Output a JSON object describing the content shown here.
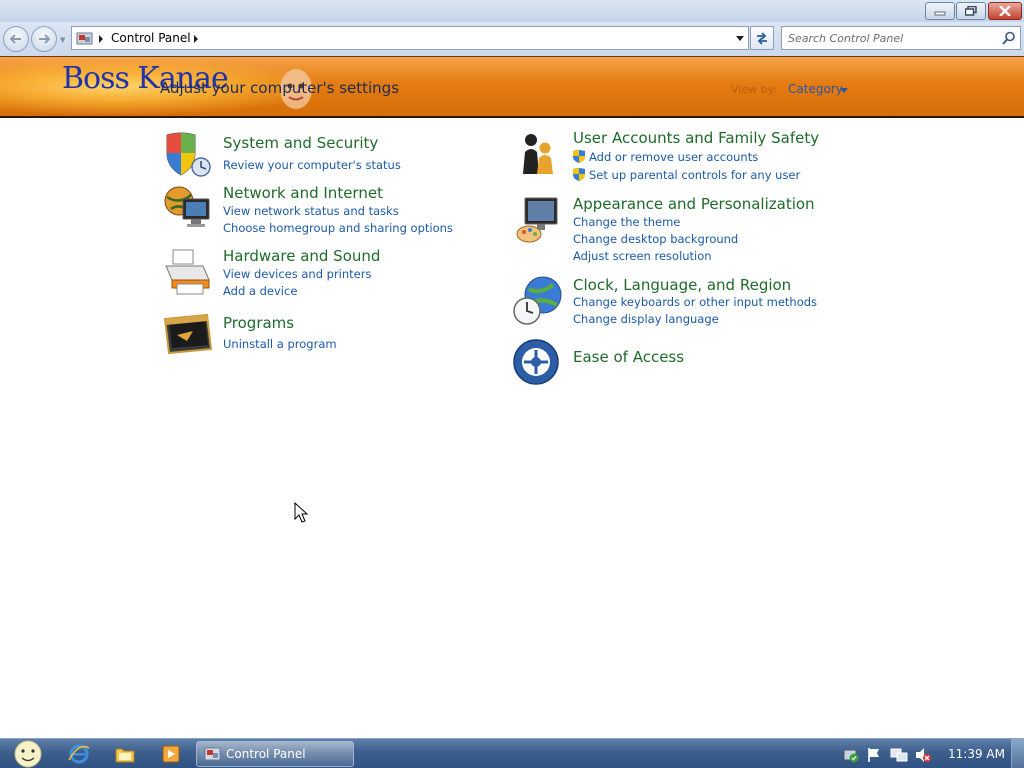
{
  "window": {
    "colors": {
      "banner": "#e47c11",
      "category_title": "#1e6b2a",
      "link": "#1c5aa8",
      "taskbar": "#3d5f8d"
    }
  },
  "navigation": {
    "breadcrumb": "Control Panel",
    "search_placeholder": "Search Control Panel"
  },
  "banner": {
    "logo_text": "Boss Kanae",
    "heading": "Adjust your computer's settings",
    "view_by_label": "View by:",
    "view_by_value": "Category"
  },
  "categories": [
    {
      "title": "System and Security",
      "icon": "security-shield-icon",
      "links": [
        "Review your computer's status"
      ]
    },
    {
      "title": "Network and Internet",
      "icon": "network-globe-icon",
      "links": [
        "View network status and tasks",
        "Choose homegroup and sharing options"
      ]
    },
    {
      "title": "Hardware and Sound",
      "icon": "printer-icon",
      "links": [
        "View devices and printers",
        "Add a device"
      ]
    },
    {
      "title": "Programs",
      "icon": "programs-icon",
      "links": [
        "Uninstall a program"
      ]
    },
    {
      "title": "User Accounts and Family Safety",
      "icon": "users-icon",
      "links": [
        "Add or remove user accounts",
        "Set up parental controls for any user"
      ]
    },
    {
      "title": "Appearance and Personalization",
      "icon": "monitor-paint-icon",
      "links": [
        "Change the theme",
        "Change desktop background",
        "Adjust screen resolution"
      ]
    },
    {
      "title": "Clock, Language, and Region",
      "icon": "clock-globe-icon",
      "links": [
        "Change keyboards or other input methods",
        "Change display language"
      ]
    },
    {
      "title": "Ease of Access",
      "icon": "ease-of-access-icon",
      "links": []
    }
  ],
  "taskbar": {
    "pinned": [
      "internet-explorer-icon",
      "explorer-folder-icon",
      "media-player-icon"
    ],
    "task_label": "Control Panel",
    "clock": "11:39 AM"
  }
}
